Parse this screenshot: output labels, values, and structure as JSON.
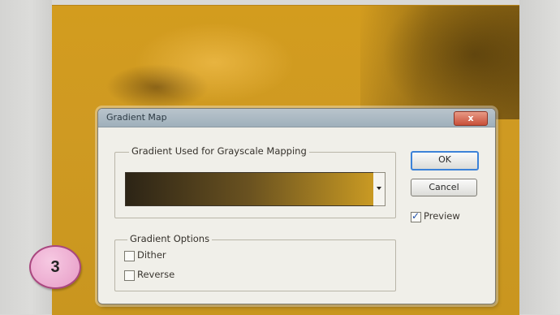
{
  "dialog": {
    "title": "Gradient Map",
    "close_label": "x",
    "mapping_group_label": "Gradient Used for Grayscale Mapping",
    "options_group_label": "Gradient Options",
    "ok_label": "OK",
    "cancel_label": "Cancel",
    "preview_label": "Preview",
    "preview_checked": true,
    "dither_label": "Dither",
    "dither_checked": false,
    "reverse_label": "Reverse",
    "reverse_checked": false,
    "gradient_colors": [
      "#2c2416",
      "#6a5220",
      "#c99a23"
    ]
  },
  "badge": {
    "step_number": "3",
    "color": "#e79bc6"
  }
}
